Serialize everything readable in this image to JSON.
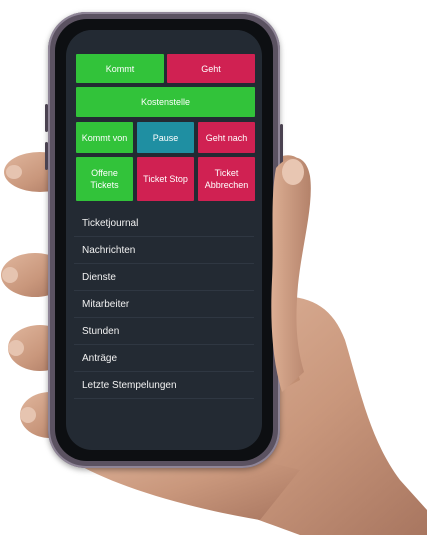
{
  "buttons": {
    "kommt": "Kommt",
    "geht": "Geht",
    "kostenstelle": "Kostenstelle",
    "kommt_von": "Kommt von",
    "pause": "Pause",
    "geht_nach": "Geht nach",
    "offene_tickets": "Offene\nTickets",
    "ticket_stop": "Ticket Stop",
    "ticket_abbrechen": "Ticket\nAbbrechen"
  },
  "menu": {
    "items": [
      "Ticketjournal",
      "Nachrichten",
      "Dienste",
      "Mitarbeiter",
      "Stunden",
      "Anträge",
      "Letzte Stempelungen"
    ]
  },
  "colors": {
    "green": "#32c33a",
    "red": "#d02152",
    "teal": "#1f8fa2",
    "screen_bg": "#232a33",
    "skin": "#c99a7f"
  }
}
